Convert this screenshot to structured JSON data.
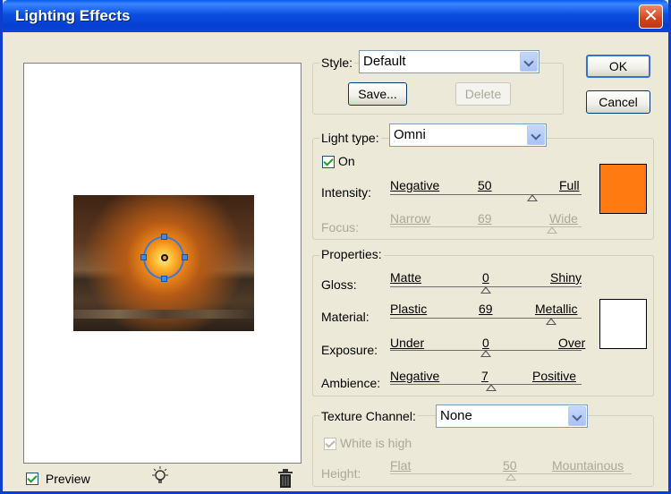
{
  "window": {
    "title": "Lighting Effects",
    "close_glyph": "✕"
  },
  "buttons": {
    "ok": "OK",
    "cancel": "Cancel",
    "save": "Save...",
    "delete": "Delete"
  },
  "style": {
    "label": "Style:",
    "value": "Default"
  },
  "light": {
    "type_label": "Light type:",
    "type_value": "Omni",
    "on_label": "On",
    "on_checked": true,
    "color": "#ff7a10",
    "intensity": {
      "label": "Intensity:",
      "min": "Negative",
      "max": "Full",
      "value": "50",
      "position": 0.75
    },
    "focus": {
      "label": "Focus:",
      "min": "Narrow",
      "max": "Wide",
      "value": "69",
      "position": 0.85,
      "disabled": true
    }
  },
  "properties": {
    "title": "Properties:",
    "color": "#ffffff",
    "gloss": {
      "label": "Gloss:",
      "min": "Matte",
      "max": "Shiny",
      "value": "0",
      "position": 0.5
    },
    "material": {
      "label": "Material:",
      "min": "Plastic",
      "max": "Metallic",
      "value": "69",
      "position": 0.85
    },
    "exposure": {
      "label": "Exposure:",
      "min": "Under",
      "max": "Over",
      "value": "0",
      "position": 0.5
    },
    "ambience": {
      "label": "Ambience:",
      "min": "Negative",
      "max": "Positive",
      "value": "7",
      "position": 0.54
    }
  },
  "texture": {
    "channel_label": "Texture Channel:",
    "channel_value": "None",
    "white_is_high_label": "White is high",
    "height": {
      "label": "Height:",
      "min": "Flat",
      "max": "Mountainous",
      "value": "50",
      "position": 0.5
    }
  },
  "preview": {
    "label": "Preview",
    "checked": true
  },
  "icons": {
    "bulb": "light-bulb-icon",
    "trash": "trash-icon"
  },
  "colors": {
    "title_bar": "#0a4fe0",
    "dialog_bg": "#ece9d8"
  }
}
